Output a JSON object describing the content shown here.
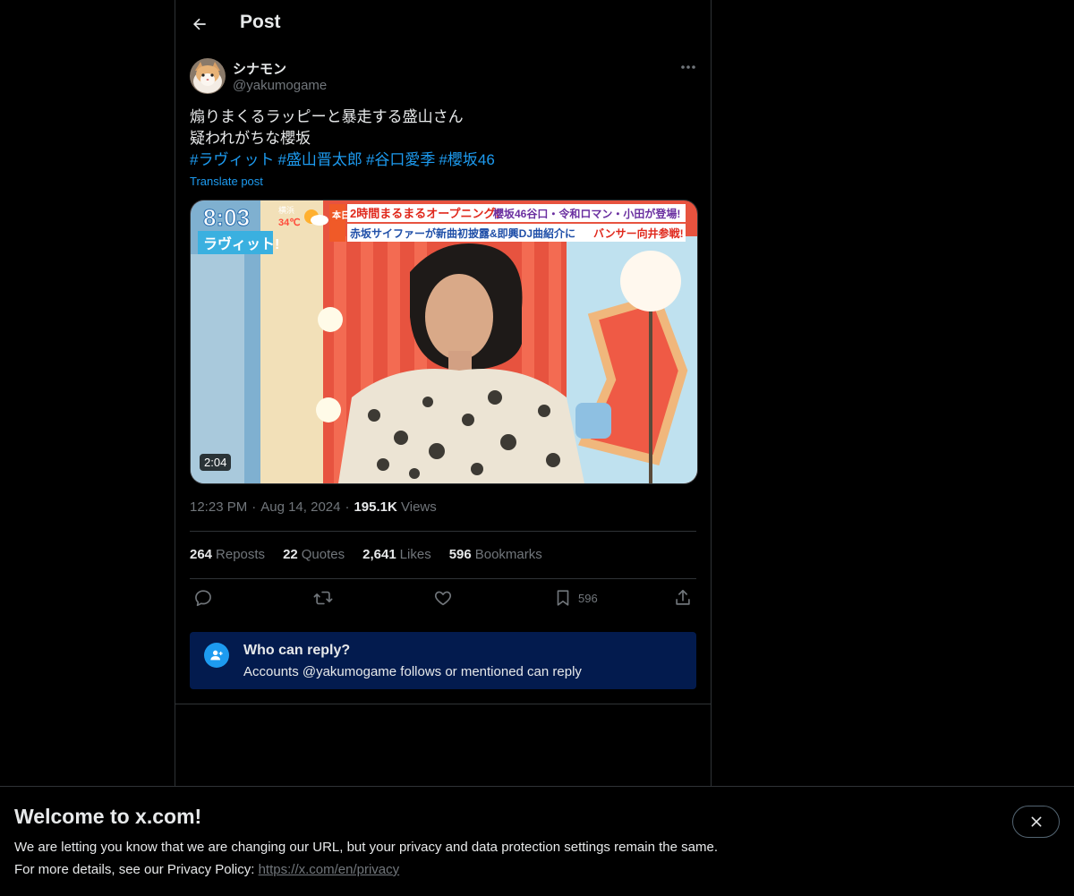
{
  "header": {
    "title": "Post"
  },
  "author": {
    "name": "シナモン",
    "handle": "@yakumogame"
  },
  "post": {
    "line1": "煽りまくるラッピーと暴走する盛山さん",
    "line2": "疑われがちな櫻坂",
    "hashtags": [
      "#ラヴィット",
      "#盛山晋太郎",
      "#谷口愛季",
      "#櫻坂46"
    ],
    "translate_label": "Translate post"
  },
  "media": {
    "duration": "2:04",
    "tv": {
      "clock": "8:03",
      "show_logo": "ラヴィット!",
      "weather_city": "横浜",
      "weather_temp": "34℃",
      "today_label": "本日は",
      "row1a": "2時間まるまるオープニング!",
      "row1b": "櫻坂46谷口・令和ロマン・小田が登場!",
      "row2a": "赤坂サイファーが新曲初披露&即興DJ曲紹介に",
      "row2b": "バンサー向井参戦!"
    }
  },
  "meta": {
    "time": "12:23 PM",
    "date": "Aug 14, 2024",
    "views_count": "195.1K",
    "views_label": "Views"
  },
  "stats": {
    "reposts_count": "264",
    "reposts_label": "Reposts",
    "quotes_count": "22",
    "quotes_label": "Quotes",
    "likes_count": "2,641",
    "likes_label": "Likes",
    "bookmarks_count": "596",
    "bookmarks_label": "Bookmarks"
  },
  "actions": {
    "bookmark_count": "596"
  },
  "who_can_reply": {
    "title": "Who can reply?",
    "description": "Accounts @yakumogame follows or mentioned can reply"
  },
  "banner": {
    "title": "Welcome to x.com!",
    "text1": "We are letting you know that we are changing our URL, but your privacy and data protection settings remain the same.",
    "text2_prefix": "For more details, see our Privacy Policy: ",
    "link": "https://x.com/en/privacy"
  },
  "colors": {
    "accent": "#1d9bf0",
    "background": "#000000",
    "reply_box": "#031b4e",
    "muted": "#71767b"
  },
  "icons": [
    "back-arrow-icon",
    "more-icon",
    "reply-icon",
    "repost-icon",
    "like-icon",
    "bookmark-icon",
    "share-icon",
    "person-add-icon",
    "close-icon"
  ]
}
